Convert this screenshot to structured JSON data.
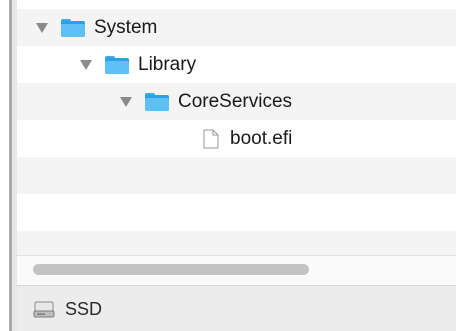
{
  "tree": {
    "items": [
      {
        "label": "System",
        "expanded": true,
        "icon": "folder-icon"
      },
      {
        "label": "Library",
        "expanded": true,
        "icon": "folder-icon"
      },
      {
        "label": "CoreServices",
        "expanded": true,
        "icon": "folder-icon"
      },
      {
        "label": "boot.efi",
        "icon": "document-icon"
      }
    ]
  },
  "scrollbar": {
    "visible": true
  },
  "pathbar": {
    "label": "SSD",
    "icon": "disk-icon"
  },
  "colors": {
    "folder": "#2fa0e8",
    "stripe": "#f4f4f5",
    "pathbar": "#ececec"
  }
}
